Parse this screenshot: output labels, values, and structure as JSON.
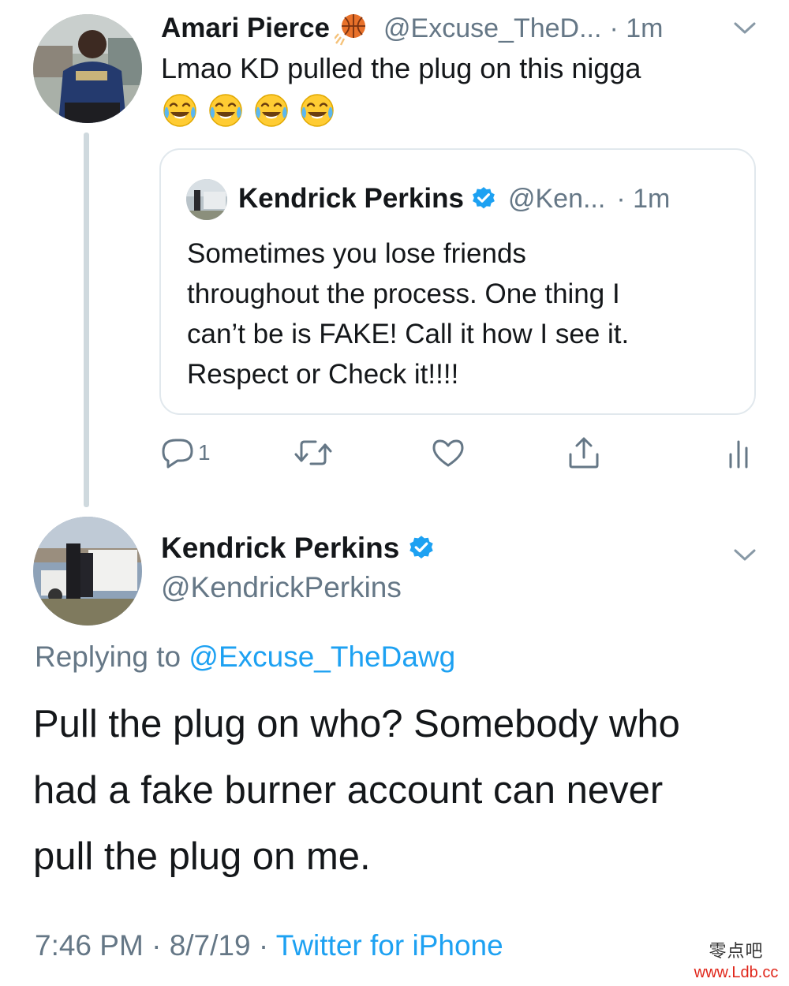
{
  "tweet1": {
    "name": "Amari Pierce",
    "name_emoji_icon": "basketball-icon",
    "handle": "@Excuse_TheD...",
    "time": "· 1m",
    "text": "Lmao KD pulled the plug on this nigga",
    "emoji_icons": [
      "face-with-tears-of-joy-icon",
      "face-with-tears-of-joy-icon",
      "face-with-tears-of-joy-icon",
      "face-with-tears-of-joy-icon"
    ]
  },
  "quoted": {
    "name": "Kendrick Perkins",
    "handle": "@Ken...",
    "time": "· 1m",
    "lines": [
      "Sometimes you lose friends",
      "throughout the process. One thing I",
      "can’t be is FAKE! Call it how I see it.",
      "Respect or Check it!!!!"
    ]
  },
  "actions": {
    "reply_count": "1",
    "icons": [
      "reply-icon",
      "retweet-icon",
      "like-icon",
      "share-icon",
      "analytics-icon"
    ]
  },
  "tweet2": {
    "name": "Kendrick Perkins",
    "handle": "@KendrickPerkins",
    "replying_prefix": "Replying to ",
    "replying_to": "@Excuse_TheDawg",
    "lines": [
      "Pull the plug on who? Somebody who",
      "had a fake burner account can never",
      "pull the plug on me."
    ],
    "time": "7:46 PM",
    "date": "8/7/19",
    "separator": " · ",
    "source": "Twitter for iPhone"
  },
  "watermark": {
    "chinese": "零点吧",
    "url": "www.Ldb.cc"
  },
  "colors": {
    "link": "#1da1f2",
    "muted": "#657786",
    "verified": "#1da1f2",
    "text": "#14171a"
  }
}
